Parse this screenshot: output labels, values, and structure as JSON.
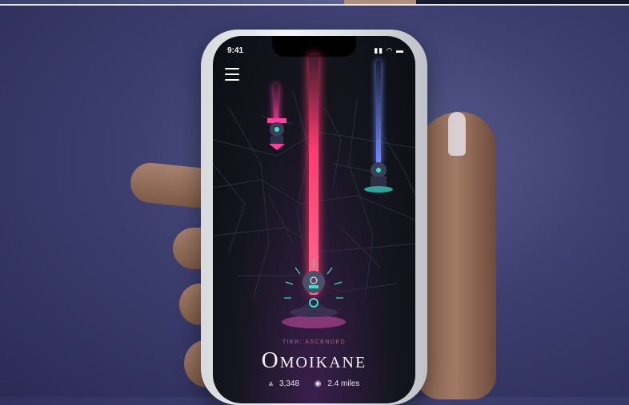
{
  "status_bar": {
    "time": "9:41",
    "icons": "signal wifi battery"
  },
  "menu": {
    "icon": "hamburger-menu-icon"
  },
  "location": {
    "tier": "TIER: ASCENDED",
    "name": "Omoikane",
    "followers_icon": "altar-icon",
    "followers": "3,348",
    "distance_icon": "compass-icon",
    "distance": "2.4 miles"
  },
  "colors": {
    "beam_center": "#ff3b6e",
    "beam_left": "#ff3fa0",
    "beam_right": "#6f8cff",
    "tier_text": "#d0577e",
    "accent_cyan": "#37e0d0"
  }
}
